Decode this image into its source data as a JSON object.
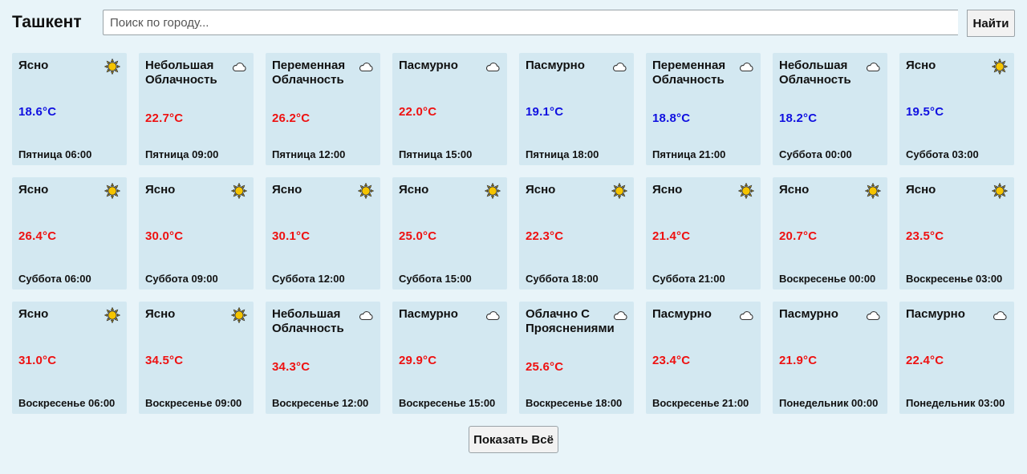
{
  "header": {
    "city": "Ташкент",
    "search_placeholder": "Поиск по городу...",
    "search_value": "",
    "search_button": "Найти"
  },
  "colors": {
    "background": "#e8f4f9",
    "card": "#d3e8f1",
    "temp_cold": "#1010e0",
    "temp_warm": "#ee1111",
    "sun": "#f5c400"
  },
  "forecast": [
    {
      "condition": "Ясно",
      "temp": "18.6°C",
      "datetime": "Пятница 06:00",
      "icon": "sun-icon",
      "tone": "cold"
    },
    {
      "condition": "Небольшая Облачность",
      "temp": "22.7°C",
      "datetime": "Пятница 09:00",
      "icon": "cloud-icon",
      "tone": "warm"
    },
    {
      "condition": "Переменная Облачность",
      "temp": "26.2°C",
      "datetime": "Пятница 12:00",
      "icon": "cloud-icon",
      "tone": "warm"
    },
    {
      "condition": "Пасмурно",
      "temp": "22.0°C",
      "datetime": "Пятница 15:00",
      "icon": "cloud-icon",
      "tone": "warm"
    },
    {
      "condition": "Пасмурно",
      "temp": "19.1°C",
      "datetime": "Пятница 18:00",
      "icon": "cloud-icon",
      "tone": "cold"
    },
    {
      "condition": "Переменная Облачность",
      "temp": "18.8°C",
      "datetime": "Пятница 21:00",
      "icon": "cloud-icon",
      "tone": "cold"
    },
    {
      "condition": "Небольшая Облачность",
      "temp": "18.2°C",
      "datetime": "Суббота 00:00",
      "icon": "cloud-icon",
      "tone": "cold"
    },
    {
      "condition": "Ясно",
      "temp": "19.5°C",
      "datetime": "Суббота 03:00",
      "icon": "sun-icon",
      "tone": "cold"
    },
    {
      "condition": "Ясно",
      "temp": "26.4°C",
      "datetime": "Суббота 06:00",
      "icon": "sun-icon",
      "tone": "warm"
    },
    {
      "condition": "Ясно",
      "temp": "30.0°C",
      "datetime": "Суббота 09:00",
      "icon": "sun-icon",
      "tone": "warm"
    },
    {
      "condition": "Ясно",
      "temp": "30.1°C",
      "datetime": "Суббота 12:00",
      "icon": "sun-icon",
      "tone": "warm"
    },
    {
      "condition": "Ясно",
      "temp": "25.0°C",
      "datetime": "Суббота 15:00",
      "icon": "sun-icon",
      "tone": "warm"
    },
    {
      "condition": "Ясно",
      "temp": "22.3°C",
      "datetime": "Суббота 18:00",
      "icon": "sun-icon",
      "tone": "warm"
    },
    {
      "condition": "Ясно",
      "temp": "21.4°C",
      "datetime": "Суббота 21:00",
      "icon": "sun-icon",
      "tone": "warm"
    },
    {
      "condition": "Ясно",
      "temp": "20.7°C",
      "datetime": "Воскресенье 00:00",
      "icon": "sun-icon",
      "tone": "warm"
    },
    {
      "condition": "Ясно",
      "temp": "23.5°C",
      "datetime": "Воскресенье 03:00",
      "icon": "sun-icon",
      "tone": "warm"
    },
    {
      "condition": "Ясно",
      "temp": "31.0°C",
      "datetime": "Воскресенье 06:00",
      "icon": "sun-icon",
      "tone": "warm"
    },
    {
      "condition": "Ясно",
      "temp": "34.5°C",
      "datetime": "Воскресенье 09:00",
      "icon": "sun-icon",
      "tone": "warm"
    },
    {
      "condition": "Небольшая Облачность",
      "temp": "34.3°C",
      "datetime": "Воскресенье 12:00",
      "icon": "cloud-icon",
      "tone": "warm"
    },
    {
      "condition": "Пасмурно",
      "temp": "29.9°C",
      "datetime": "Воскресенье 15:00",
      "icon": "cloud-icon",
      "tone": "warm"
    },
    {
      "condition": "Облачно С Прояснениями",
      "temp": "25.6°C",
      "datetime": "Воскресенье 18:00",
      "icon": "cloud-icon",
      "tone": "warm"
    },
    {
      "condition": "Пасмурно",
      "temp": "23.4°C",
      "datetime": "Воскресенье 21:00",
      "icon": "cloud-icon",
      "tone": "warm"
    },
    {
      "condition": "Пасмурно",
      "temp": "21.9°C",
      "datetime": "Понедельник 00:00",
      "icon": "cloud-icon",
      "tone": "warm"
    },
    {
      "condition": "Пасмурно",
      "temp": "22.4°C",
      "datetime": "Понедельник 03:00",
      "icon": "cloud-icon",
      "tone": "warm"
    }
  ],
  "footer": {
    "show_all_button": "Показать Всё"
  }
}
